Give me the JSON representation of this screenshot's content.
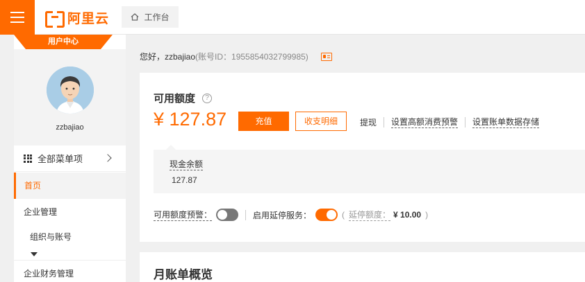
{
  "brand": {
    "name": "阿里云",
    "accent": "#ff6a00"
  },
  "topbar": {
    "workbench_label": "工作台"
  },
  "sidebar": {
    "user_center_label": "用户中心",
    "username": "zzbajiao",
    "all_menu_label": "全部菜单项",
    "items": [
      {
        "label": "首页",
        "active": true
      },
      {
        "label": "企业管理"
      },
      {
        "label": "组织与账号"
      },
      {
        "label": "企业财务管理"
      }
    ]
  },
  "main": {
    "greeting": "您好，zzbajiao",
    "account_id": "(账号ID：1955854032799985)",
    "balance": {
      "title": "可用额度",
      "amount": "¥ 127.87",
      "recharge_label": "充值",
      "detail_label": "收支明细",
      "links": [
        "提现",
        "设置高额消费预警",
        "设置账单数据存储"
      ],
      "cash_label": "现金余额",
      "cash_value": "127.87"
    },
    "toggles": {
      "alert_label": "可用额度预警：",
      "alert_on": false,
      "grace_service_label": "启用延停服务：",
      "grace_service_on": true,
      "paren_open": "(",
      "grace_amount_label": "延停额度：",
      "grace_amount_value": "¥ 10.00",
      "paren_close": ")"
    },
    "monthly_title": "月账单概览"
  }
}
